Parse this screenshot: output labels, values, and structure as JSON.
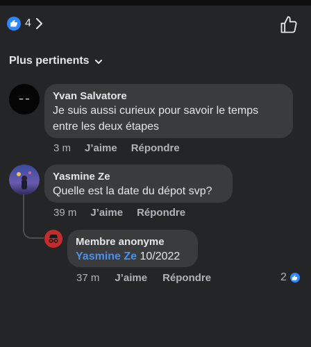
{
  "header": {
    "like_count": "4",
    "like_icon": "like-badge-icon",
    "like_button_icon": "thumbs-up-outline-icon"
  },
  "sort": {
    "label": "Plus pertinents"
  },
  "comments": [
    {
      "author": "Yvan Salvatore",
      "text": "Je suis aussi curieux pour savoir le temps entre les deux étapes",
      "time": "3 m",
      "like_label": "J’aime",
      "reply_label": "Répondre"
    },
    {
      "author": "Yasmine Ze",
      "text": "Quelle est la date du dépot svp?",
      "time": "39 m",
      "like_label": "J’aime",
      "reply_label": "Répondre"
    }
  ],
  "reply": {
    "author": "Membre anonyme",
    "mention": "Yasmine Ze",
    "text": " 10/2022",
    "time": "37 m",
    "like_label": "J’aime",
    "reply_label": "Répondre",
    "reaction_count": "2"
  },
  "colors": {
    "background": "#242526",
    "bubble": "#3a3b3c",
    "accent": "#2d88ff",
    "mention": "#4b8ff0"
  }
}
